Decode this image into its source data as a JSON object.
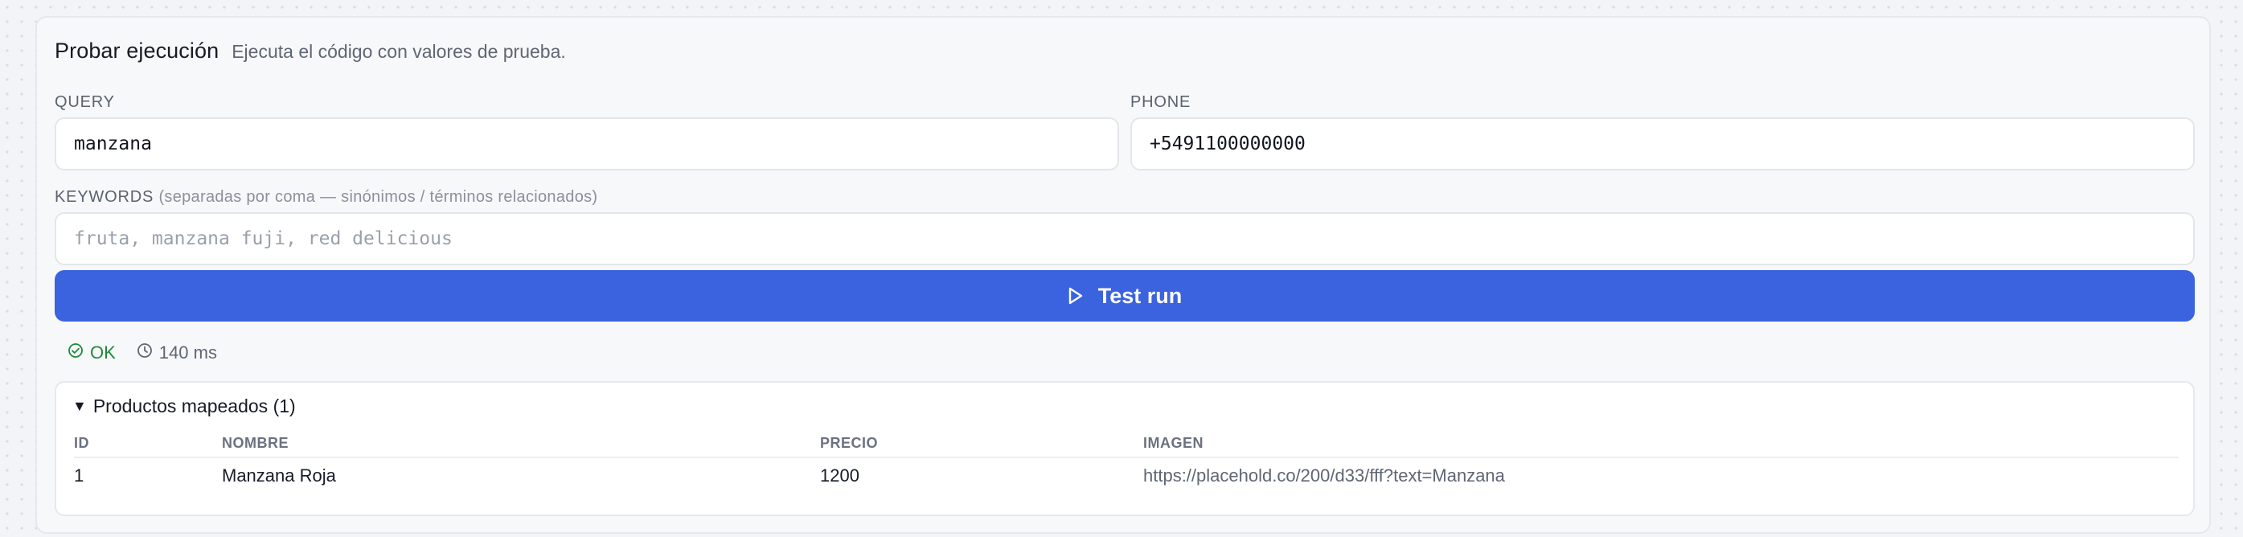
{
  "panel": {
    "title": "Probar ejecución",
    "subtitle": "Ejecuta el código con valores de prueba."
  },
  "fields": {
    "query": {
      "label": "QUERY",
      "value": "manzana"
    },
    "phone": {
      "label": "PHONE",
      "value": "+5491100000000"
    },
    "keywords": {
      "label": "KEYWORDS",
      "hint": "(separadas por coma — sinónimos / términos relacionados)",
      "placeholder": "fruta, manzana fuji, red delicious",
      "value": ""
    }
  },
  "run_button": {
    "label": "Test run",
    "icon": "play-icon",
    "color": "#3b63e0"
  },
  "status": {
    "state": "OK",
    "state_icon": "check-circle-icon",
    "state_color": "#1f8a3b",
    "duration": "140 ms",
    "duration_icon": "clock-icon"
  },
  "results": {
    "summary": "Productos mapeados (1)",
    "expanded": true,
    "columns": [
      "ID",
      "NOMBRE",
      "PRECIO",
      "IMAGEN"
    ],
    "rows": [
      {
        "id": "1",
        "nombre": "Manzana Roja",
        "precio": "1200",
        "imagen": "https://placehold.co/200/d33/fff?text=Manzana"
      }
    ]
  }
}
